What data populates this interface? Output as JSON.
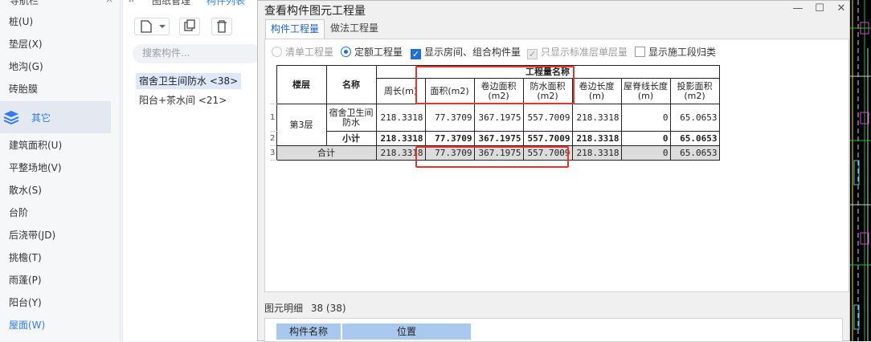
{
  "nav": {
    "header": "导航栏",
    "items_top": [
      "桩(U)",
      "垫层(X)",
      "地沟(G)",
      "砖胎膜"
    ],
    "group_label": "其它",
    "items_bottom": [
      "建筑面积(U)",
      "平整场地(V)",
      "散水(S)",
      "台阶",
      "后浇带(JD)",
      "挑檐(T)",
      "雨蓬(P)",
      "阳台(Y)",
      "屋面(W)"
    ]
  },
  "mid": {
    "tabs": [
      "图纸管理",
      "构件列表"
    ],
    "search_placeholder": "搜索构件...",
    "items": [
      "宿舍卫生间防水 <38>",
      "阳台+茶水间 <21>"
    ]
  },
  "dialog": {
    "title": "查看构件图元工程量",
    "tabs": [
      "构件工程量",
      "做法工程量"
    ],
    "options": {
      "qingdan": "清单工程量",
      "dinge": "定额工程量",
      "show_rooms": "显示房间、组合构件量",
      "std_floor": "只显示标准层单层量",
      "construction": "显示施工段归类"
    },
    "table": {
      "head_floor": "楼层",
      "head_name": "名称",
      "head_group": "工程量名称",
      "columns": [
        "周长(m)",
        "面积(m2)",
        "卷边面积(m2)",
        "防水面积(m2)",
        "卷边长度(m)",
        "屋脊线长度(m)",
        "投影面积(m2)"
      ],
      "row_numbers": [
        "1",
        "2",
        "3"
      ],
      "rows": [
        {
          "floor": "第3层",
          "name": "宿舍卫生间防水",
          "values": [
            "218.3318",
            "77.3709",
            "367.1975",
            "557.7009",
            "218.3318",
            "0",
            "65.0653"
          ]
        },
        {
          "name": "小计",
          "values": [
            "218.3318",
            "77.3709",
            "367.1975",
            "557.7009",
            "218.3318",
            "0",
            "65.0653"
          ]
        },
        {
          "name": "合计",
          "values": [
            "218.3318",
            "77.3709",
            "367.1975",
            "557.7009",
            "218.3318",
            "0",
            "65.0653"
          ]
        }
      ]
    },
    "detail_label": "图元明细",
    "detail_count": "38 (38)",
    "detail_cols": [
      "构件名称",
      "位置"
    ]
  },
  "colors": {
    "accent": "#2f7bf2",
    "highlight": "#e8332d",
    "selected_bg": "#dde8fb"
  }
}
